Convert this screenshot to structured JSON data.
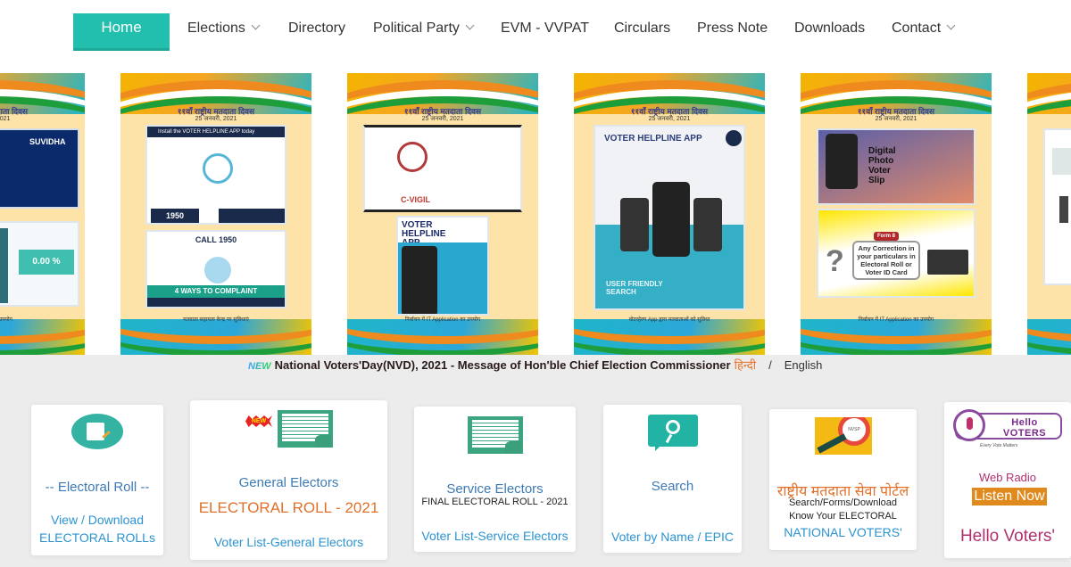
{
  "nav": {
    "home": "Home",
    "items": [
      {
        "label": "Elections",
        "dropdown": true
      },
      {
        "label": "Directory",
        "dropdown": false
      },
      {
        "label": "Political Party",
        "dropdown": true
      },
      {
        "label": "EVM - VVPAT",
        "dropdown": false
      },
      {
        "label": "Circulars",
        "dropdown": false
      },
      {
        "label": "Press Note",
        "dropdown": false
      },
      {
        "label": "Downloads",
        "dropdown": false
      },
      {
        "label": "Contact",
        "dropdown": true
      }
    ],
    "active_color": "#22bfae"
  },
  "banner": {
    "poster_title": "११वाँ राष्ट्रीय मतदाता दिवस",
    "poster_date": "25 जनवरी, 2021",
    "posters": [
      {
        "panel_top": "SUVIDHA",
        "panel_bottom": "0.00 %",
        "footer": "…सॉफ्टवेयर का उपयोग"
      },
      {
        "panel_top": "Install the VOTER HELPLINE APP today",
        "hotline": "1950",
        "panel_bottom": "4 WAYS TO COMPLAINT",
        "call": "CALL 1950",
        "footer": "मतदाता सहायता केन्द्र पर सुविधाएं"
      },
      {
        "panel_top": "C-VIGIL",
        "panel_bottom": "VOTER HELPLINE APP",
        "footer": "निर्वाचन में IT Application का उपयोग"
      },
      {
        "panel_top": "VOTER HELPLINE APP",
        "panel_bottom": "USER FRIENDLY SEARCH",
        "footer": "वोटरहेल्प App द्वारा मतदाताओं को सुविधा"
      },
      {
        "panel_top": "Digital Photo Voter Slip",
        "panel_bottom": "Any Correction in your particulars in Electoral Roll or Voter ID Card",
        "form": "Form 8",
        "footer": "निर्वाचन में IT Application का उपयोग"
      },
      {
        "panel_top": "",
        "panel_bottom": "",
        "footer": ""
      }
    ]
  },
  "ticker": {
    "badge": "NEW",
    "message": "National Voters'Day(NVD), 2021 - Message of Hon'ble Chief Election Commissioner",
    "hindi_link": "हिन्दी",
    "separator": "/",
    "english_link": "English"
  },
  "cards": [
    {
      "title": "-- Electoral Roll --",
      "link": "View / Download",
      "link2": "ELECTORAL ROLLs",
      "icon": "checklist-icon"
    },
    {
      "badge": "NEW",
      "title": "General Electors",
      "highlight": "ELECTORAL ROLL - 2021",
      "link": "Voter List-General Electors",
      "icon": "evm-ballot-icon"
    },
    {
      "title": "Service Electors",
      "subtitle": "FINAL ELECTORAL ROLL - 2021",
      "link": "Voter List-Service Electors",
      "icon": "evm-ballot-icon"
    },
    {
      "title": "Search",
      "link": "Voter by Name / EPIC",
      "icon": "search-chat-icon"
    },
    {
      "title": "राष्ट्रीय मतदाता सेवा पोर्टल",
      "line1": "Search/Forms/Download",
      "line2": "Know Your ELECTORAL",
      "link": "NATIONAL VOTERS'",
      "icon": "magnifier-pen-icon",
      "image_text": "NVSP"
    },
    {
      "logo": "Hello VOTERS",
      "tagline": "Every Vote Matters",
      "title": "Web Radio",
      "button": "Listen Now",
      "link": "Hello Voters'",
      "icon": "microphone-icon"
    }
  ]
}
